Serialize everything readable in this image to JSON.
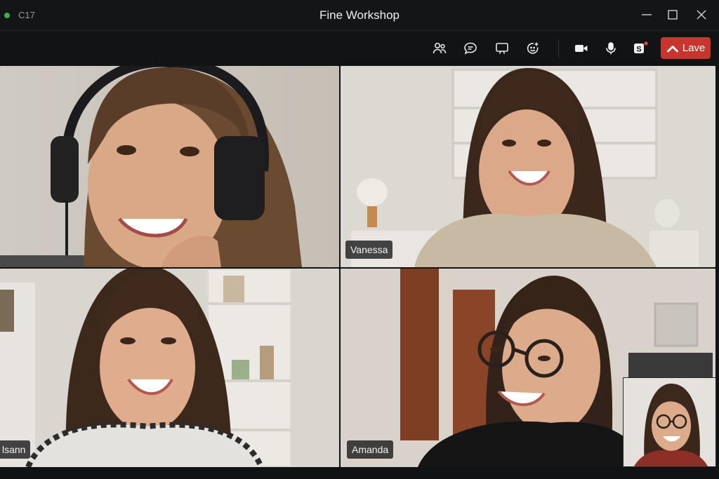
{
  "window": {
    "status_code": "C17",
    "title": "Fine Workshop"
  },
  "toolbar": {
    "buttons": [
      {
        "name": "participants-icon"
      },
      {
        "name": "chat-icon"
      },
      {
        "name": "share-screen-icon"
      },
      {
        "name": "reactions-icon"
      },
      {
        "name": "camera-icon"
      },
      {
        "name": "microphone-icon"
      },
      {
        "name": "apps-icon"
      }
    ],
    "leave_label": "Lave"
  },
  "colors": {
    "leave": "#c8352f",
    "recording_dot": "#3fae4d",
    "notification_dot": "#e0443e"
  },
  "participants": {
    "top_left": {
      "label": ""
    },
    "top_right": {
      "label": "Vanessa"
    },
    "bottom_left": {
      "label": "lsann"
    },
    "bottom_right": {
      "label": "Amanda"
    }
  }
}
